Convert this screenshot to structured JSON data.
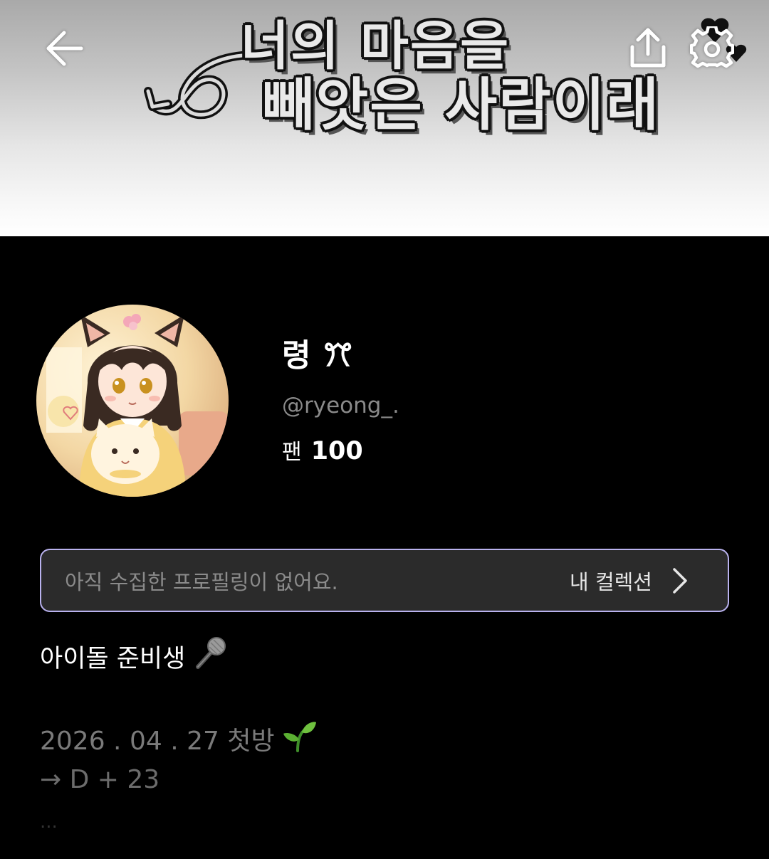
{
  "header": {
    "banner_title_line1": "너의 마음을",
    "banner_title_line2": "빼앗은 사람이래"
  },
  "profile": {
    "display_name": "령 ꔫ",
    "handle": "@ryeong_.",
    "fans_label": "팬",
    "fans_count": "100"
  },
  "collection": {
    "empty_message": "아직 수집한 프로필링이 없어요.",
    "link_label": "내 컬렉션"
  },
  "bio": {
    "line1": "아이돌 준비생",
    "line1_emoji": "microphone-icon",
    "line2": "2026 . 04 . 27 첫방",
    "line2_emoji": "seedling-icon",
    "line3": "→ D + 23",
    "line4": "..."
  },
  "colors": {
    "background": "#000000",
    "collection_border": "#b9b2ee",
    "collection_bg": "#2b2b2b",
    "muted_text": "#8a8a8a"
  }
}
